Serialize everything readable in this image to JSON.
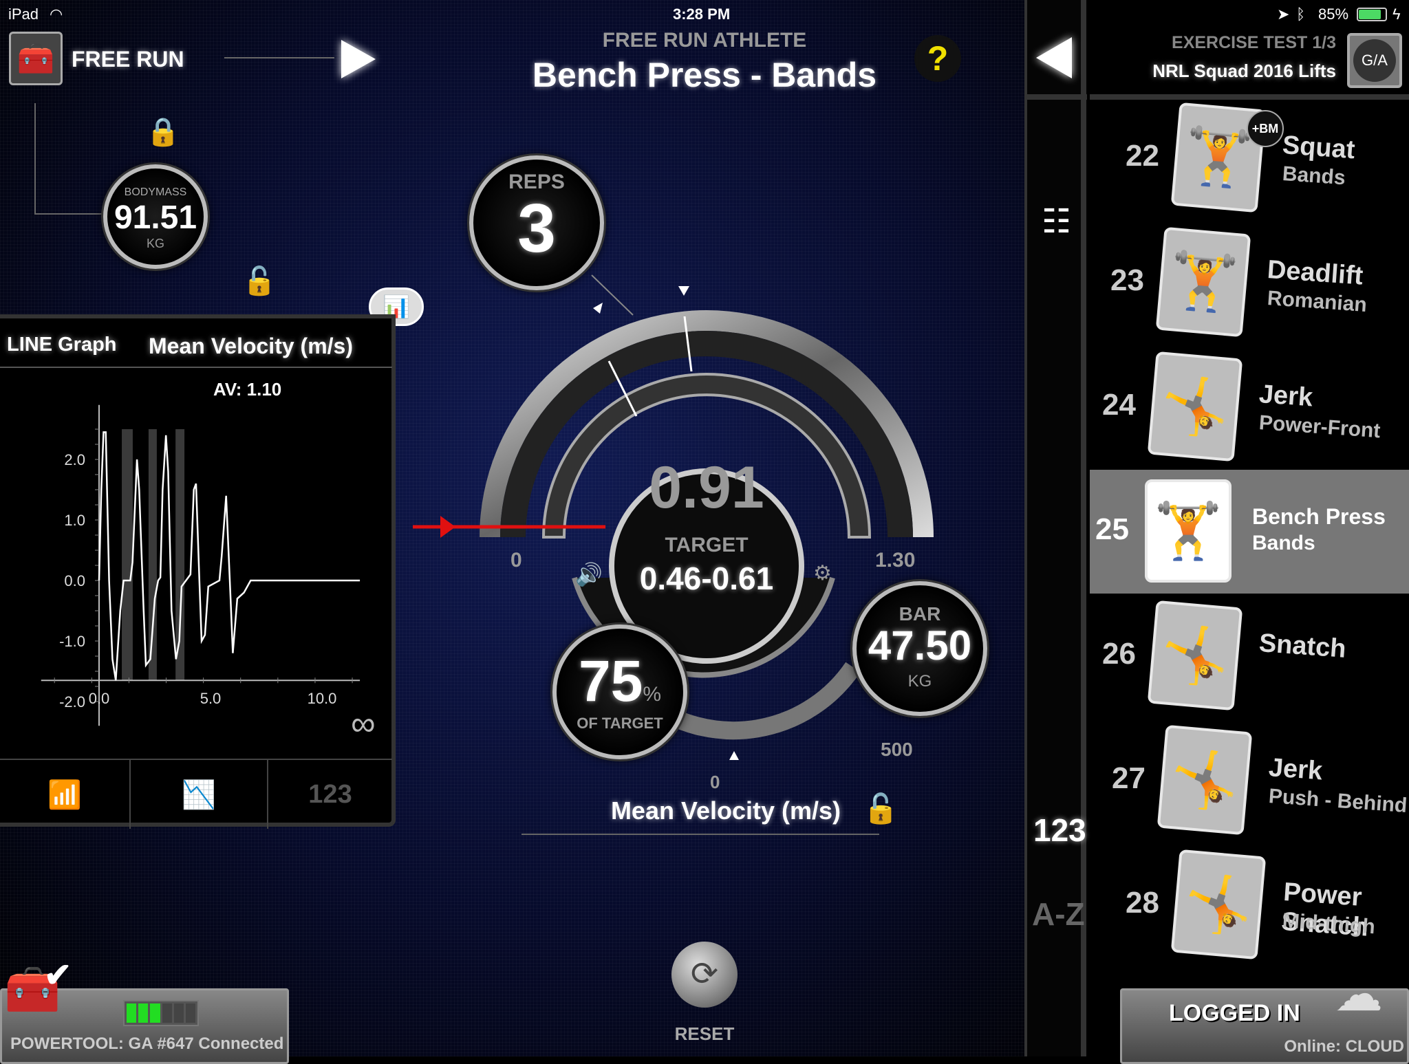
{
  "status_bar": {
    "device": "iPad",
    "time": "3:28 PM",
    "battery": "85%",
    "battery_level": 85
  },
  "header": {
    "mode_label": "FREE RUN",
    "subtitle": "FREE RUN ATHLETE",
    "title": "Bench Press - Bands",
    "help": "?"
  },
  "exercise_header": {
    "test": "EXERCISE TEST 1/3",
    "program": "NRL Squad 2016 Lifts",
    "avatar": "G/A"
  },
  "bodymass": {
    "label": "BODYMASS",
    "value": "91.51",
    "unit": "KG"
  },
  "graph_panel": {
    "type_label": "LINE Graph",
    "metric_label": "Mean Velocity (m/s)",
    "average": "AV: 1.10",
    "infinity": "∞",
    "tabs": [
      {
        "icon": "bar-chart-icon"
      },
      {
        "icon": "line-chart-icon"
      },
      {
        "label": "123"
      }
    ]
  },
  "chart_data": {
    "type": "line",
    "xlim": [
      -2.3,
      12
    ],
    "ylim": [
      -2.3,
      2.8
    ],
    "x_ticks": [
      "0.0",
      "5.0",
      "10.0"
    ],
    "x_tick_values": [
      0,
      5,
      10
    ],
    "y_ticks": [
      "2.0",
      "1.0",
      "0.0",
      "-1.0",
      "-2.0"
    ],
    "y_tick_values": [
      2,
      1,
      0,
      -1,
      -2
    ],
    "shaded_ranges": [
      [
        1.02,
        1.51
      ],
      [
        2.22,
        2.59
      ],
      [
        3.43,
        3.83
      ]
    ],
    "x": [
      0,
      0.1,
      0.2,
      0.3,
      0.45,
      0.6,
      0.75,
      0.95,
      1.1,
      1.4,
      1.5,
      1.7,
      1.8,
      2.0,
      2.1,
      2.3,
      2.5,
      2.65,
      2.75,
      2.85,
      3.0,
      3.1,
      3.25,
      3.45,
      3.6,
      3.7,
      3.9,
      4.1,
      4.25,
      4.35,
      4.5,
      4.6,
      4.75,
      4.9,
      5.4,
      5.5,
      5.7,
      5.9,
      6.0,
      6.2,
      6.5,
      6.8,
      11.7
    ],
    "y": [
      0,
      1.5,
      2.45,
      2.45,
      0,
      -1.3,
      -1.65,
      -0.5,
      0,
      0,
      0.3,
      2.0,
      1.5,
      -0.5,
      -1.4,
      -1.3,
      -0.3,
      0,
      0.05,
      1.5,
      2.4,
      1.8,
      -0.5,
      -1.3,
      -1.0,
      -0.1,
      0,
      0.1,
      1.5,
      1.6,
      0,
      -1.0,
      -0.9,
      -0.1,
      0,
      0.4,
      1.4,
      -0.3,
      -1.2,
      -0.3,
      -0.2,
      0,
      0
    ]
  },
  "gauge": {
    "reps_label": "REPS",
    "reps": "3",
    "value": "0.91",
    "target_label": "TARGET",
    "target": "0.46-0.61",
    "scale_min": "0",
    "scale_max": "1.30",
    "percent": "75",
    "percent_sign": "%",
    "percent_label": "OF TARGET",
    "bar_label": "BAR",
    "bar_value": "47.50",
    "bar_unit": "KG",
    "bar_scale_min": "0",
    "bar_scale_max": "500",
    "metric": "Mean Velocity (m/s)",
    "accent": "#e01010"
  },
  "side_nav": {
    "numeric": "123",
    "alpha": "A-Z"
  },
  "exercises": [
    {
      "num": "22",
      "name": "Squat",
      "sub": "Bands",
      "badge": "+BM"
    },
    {
      "num": "23",
      "name": "Deadlift",
      "sub": "Romanian"
    },
    {
      "num": "24",
      "name": "Jerk",
      "sub": "Power-Front"
    },
    {
      "num": "25",
      "name": "Bench Press",
      "sub": "Bands",
      "selected": true
    },
    {
      "num": "26",
      "name": "Snatch",
      "sub": ""
    },
    {
      "num": "27",
      "name": "Jerk",
      "sub": "Push - Behind"
    },
    {
      "num": "28",
      "name": "Power Snatch",
      "sub": "Mid-thigh"
    }
  ],
  "footer": {
    "reset": "RESET",
    "powertool": "POWERTOOL: GA #647 Connected",
    "logged_in": "LOGGED IN",
    "online": "Online: CLOUD",
    "device_battery_bars": 3,
    "device_battery_total": 6
  }
}
